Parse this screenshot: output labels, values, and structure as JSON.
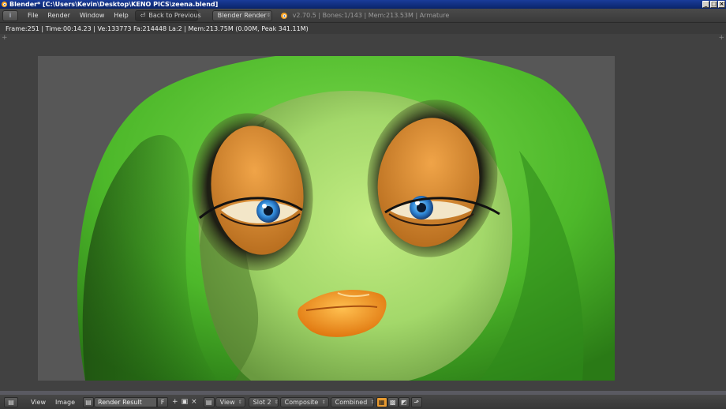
{
  "window": {
    "title": "Blender* [C:\\Users\\Kevin\\Desktop\\KENO PICS\\zeena.blend]",
    "controls": [
      "_",
      "□",
      "×"
    ]
  },
  "header": {
    "editor_type": "i",
    "menu": [
      "File",
      "Render",
      "Window",
      "Help"
    ],
    "back_button": "Back to Previous",
    "engine": "Blender Render",
    "stats": "v2.70.5 | Bones:1/143 | Mem:213.53M | Armature"
  },
  "render_info": "Frame:251 | Time:00:14.23 | Ve:133773 Fa:214448 La:2 | Mem:213.75M (0.00M, Peak 341.11M)",
  "image_editor": {
    "view_menu": "View",
    "image_menu": "Image",
    "image_name": "Render Result",
    "fake_user": "F",
    "slot": "Slot 2",
    "composite": "Composite",
    "pass": "Combined",
    "view_menu_2": "View"
  },
  "colors": {
    "accent_blue": "#0a246a",
    "render_bg": "#575757",
    "skin_green": "#a8e06a",
    "hair_green": "#56c234",
    "lips_orange": "#f5a020"
  }
}
